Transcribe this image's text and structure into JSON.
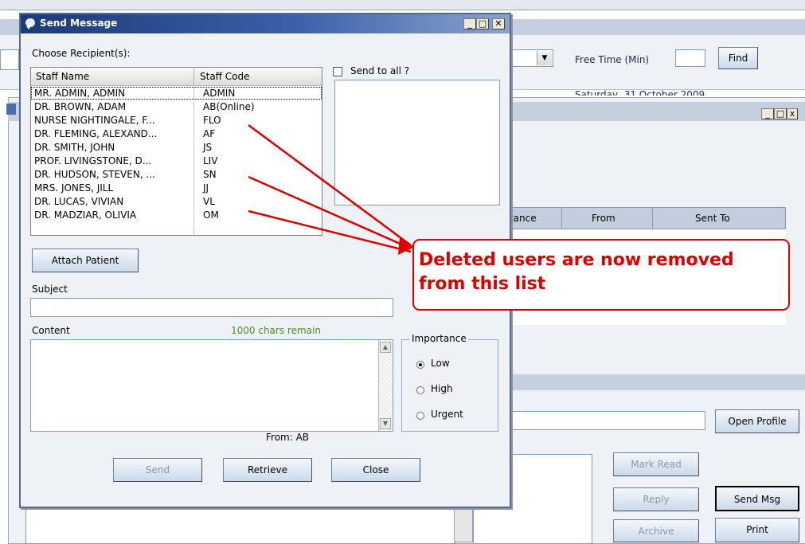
{
  "background_window": {
    "free_time_label": "Free Time (Min)",
    "free_time_value": "",
    "find_label": "Find",
    "date_text": "Saturday, 31 October 2009",
    "columns": [
      "rtance",
      "From",
      "Sent To"
    ],
    "open_profile_label": "Open Profile",
    "mark_read_label": "Mark Read",
    "reply_label": "Reply",
    "send_msg_label": "Send Msg",
    "archive_label": "Archive",
    "print_label": "Print"
  },
  "dialog": {
    "title": "Send Message",
    "choose_recipients_label": "Choose Recipient(s):",
    "send_to_all_label": "Send to all ?",
    "table": {
      "headers": [
        "Staff Name",
        "Staff Code"
      ],
      "rows": [
        [
          "MR. ADMIN, ADMIN",
          "ADMIN"
        ],
        [
          "DR. BROWN, ADAM",
          "AB(Online)"
        ],
        [
          "NURSE NIGHTINGALE, F...",
          "FLO"
        ],
        [
          "DR. FLEMING, ALEXAND...",
          "AF"
        ],
        [
          "DR. SMITH, JOHN",
          "JS"
        ],
        [
          "PROF. LIVINGSTONE, D...",
          "LIV"
        ],
        [
          "DR. HUDSON, STEVEN, ...",
          "SN"
        ],
        [
          "MRS. JONES, JILL",
          "JJ"
        ],
        [
          "DR. LUCAS, VIVIAN",
          "VL"
        ],
        [
          "DR. MADZIAR, OLIVIA",
          "OM"
        ]
      ]
    },
    "attach_patient_label": "Attach Patient",
    "subject_label": "Subject",
    "subject_value": "",
    "content_label": "Content",
    "chars_remain": "1000 chars remain",
    "content_value": "",
    "importance_label": "Importance",
    "importance_options": [
      "Low",
      "High",
      "Urgent"
    ],
    "importance_selected": "Low",
    "from_text": "From: AB",
    "send_label": "Send",
    "retrieve_label": "Retrieve",
    "close_label": "Close"
  },
  "annotation": {
    "text_line1": "Deleted users are now removed",
    "text_line2": "from this list",
    "color": "#dd0000"
  }
}
